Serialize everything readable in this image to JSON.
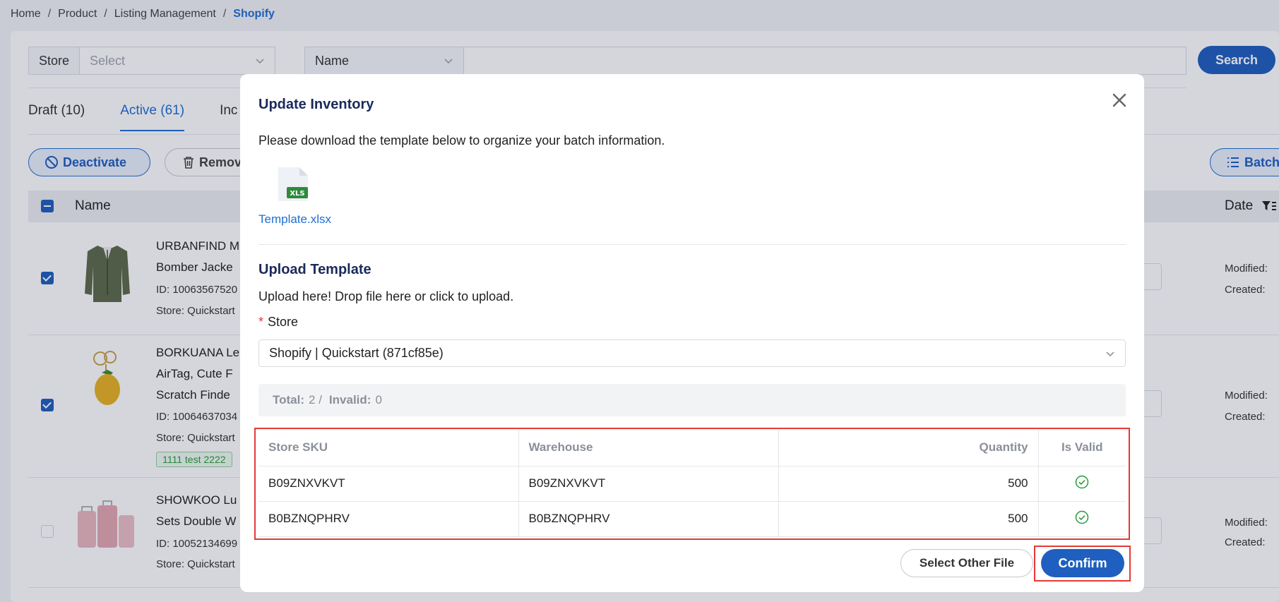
{
  "breadcrumb": {
    "items": [
      "Home",
      "Product",
      "Listing Management"
    ],
    "current": "Shopify"
  },
  "filters": {
    "store_label": "Store",
    "store_placeholder": "Select",
    "field_select": "Name",
    "search_button": "Search"
  },
  "tabs": [
    {
      "label": "Draft (10)"
    },
    {
      "label": "Active (61)"
    },
    {
      "label": "Inc"
    }
  ],
  "actions": {
    "deactivate": "Deactivate",
    "remove": "Remov",
    "batch": "Batch"
  },
  "table": {
    "col_name": "Name",
    "col_date": "Date"
  },
  "products": [
    {
      "line1": "URBANFIND M",
      "line2": "Bomber Jacke",
      "id": "ID: 10063567520",
      "store": "Store: Quickstart",
      "modified": "Modified:",
      "created": "Created:"
    },
    {
      "line1": "BORKUANA Le",
      "line2": "AirTag, Cute F",
      "line3": "Scratch Finde",
      "id": "ID: 10064637034",
      "store": "Store: Quickstart",
      "tag": "1111 test 2222",
      "modified": "Modified:",
      "created": "Created:"
    },
    {
      "line1": "SHOWKOO Lu",
      "line2": "Sets Double W",
      "id": "ID: 10052134699",
      "store": "Store: Quickstart",
      "modified": "Modified:",
      "created": "Created:"
    }
  ],
  "modal": {
    "title": "Update Inventory",
    "description": "Please download the template below to organize your batch information.",
    "file_badge": "XLS",
    "template_link": "Template.xlsx",
    "upload_title": "Upload Template",
    "upload_desc": "Upload here! Drop file here or click to upload.",
    "store_label": "Store",
    "store_value": "Shopify | Quickstart (871cf85e)",
    "total_label": "Total:",
    "total_value": "2 /",
    "invalid_label": "Invalid:",
    "invalid_value": "0",
    "columns": [
      "Store SKU",
      "Warehouse",
      "Quantity",
      "Is Valid"
    ],
    "rows": [
      {
        "sku": "B09ZNXVKVT",
        "warehouse": "B09ZNXVKVT",
        "quantity": "500",
        "valid": true
      },
      {
        "sku": "B0BZNQPHRV",
        "warehouse": "B0BZNQPHRV",
        "quantity": "500",
        "valid": true
      }
    ],
    "select_other": "Select Other File",
    "confirm": "Confirm"
  },
  "colors": {
    "primary": "#1f5fbf",
    "link": "#1f6ed4",
    "valid": "#2a9b3c",
    "highlight": "#e53935"
  }
}
